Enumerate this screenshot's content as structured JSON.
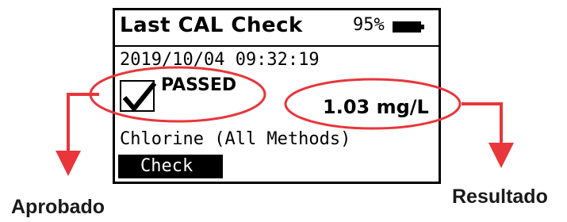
{
  "device": {
    "title": "Last CAL Check",
    "battery_percent": "95%",
    "datetime": "2019/10/04 09:32:19",
    "status": "PASSED",
    "result": "1.03 mg/L",
    "method": "Chlorine (All Methods)",
    "check_button_label": "Check"
  },
  "annotations": {
    "passed_label": "Aprobado",
    "result_label": "Resultado"
  },
  "colors": {
    "callout": "#e8363b",
    "screen_border": "#000000",
    "label_text": "#1a1a1a"
  }
}
